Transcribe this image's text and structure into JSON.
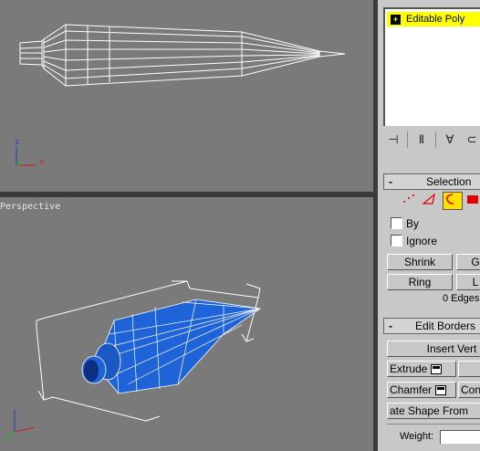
{
  "viewports": {
    "top": {
      "label": ""
    },
    "perspective": {
      "label": "Perspective"
    },
    "axis": {
      "x": "x",
      "z": "z"
    }
  },
  "modifier_stack": {
    "items": [
      {
        "label": "Editable Poly",
        "expand": "+"
      }
    ],
    "tools": [
      "pin-stack",
      "show-end-result",
      "make-unique",
      "remove-modifier"
    ]
  },
  "selection": {
    "title": "Selection",
    "collapse": "-",
    "by_label": "By",
    "ignore_label": "Ignore",
    "shrink_label": "Shrink",
    "grow_label": "G",
    "ring_label": "Ring",
    "loop_label": "L",
    "status": "0 Edges"
  },
  "edit_borders": {
    "title": "Edit Borders",
    "collapse": "-",
    "insert_vertex_label": "Insert Vert",
    "extrude_label": "Extrude",
    "chamfer_label": "Chamfer",
    "connect_label": "Con",
    "create_shape_label": "ate Shape From",
    "weight_label": "Weight:"
  },
  "colors": {
    "viewport_bg": "#7a7a7a",
    "active_modifier": "#ffff00",
    "mesh_blue": "#1e63d8"
  }
}
